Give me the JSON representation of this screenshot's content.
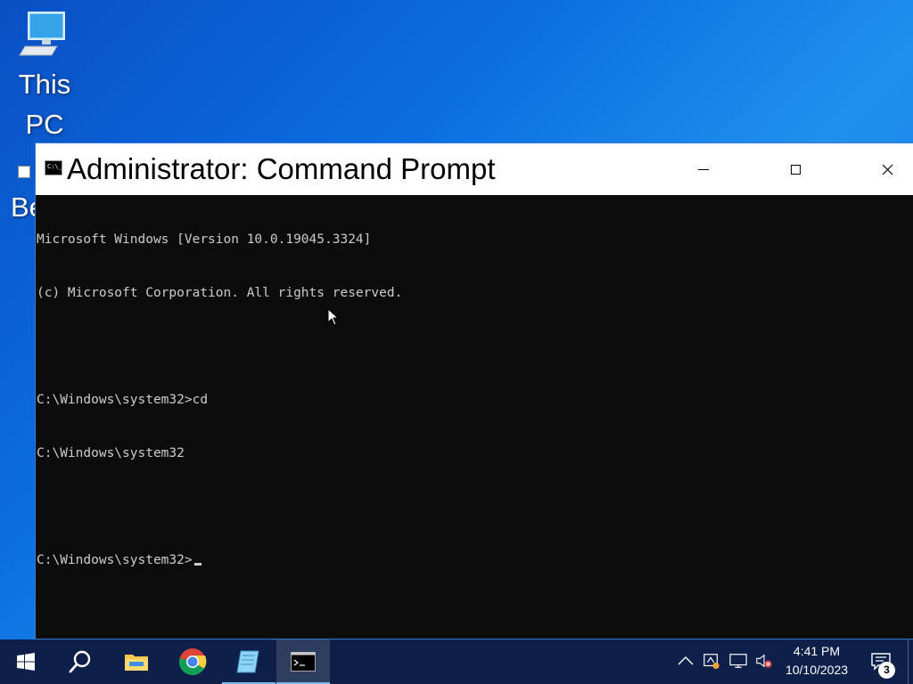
{
  "desktop": {
    "icons": [
      {
        "label_line1": "This",
        "label_line2": "PC"
      },
      {
        "label": "Be"
      }
    ]
  },
  "window": {
    "title": "Administrator: Command Prompt",
    "app_icon_text": "C:\\_",
    "controls": {
      "minimize": "minimize-icon",
      "maximize": "maximize-icon",
      "close": "close-icon"
    }
  },
  "console": {
    "lines": [
      "Microsoft Windows [Version 10.0.19045.3324]",
      "(c) Microsoft Corporation. All rights reserved.",
      "",
      "C:\\Windows\\system32>cd",
      "C:\\Windows\\system32",
      "",
      "C:\\Windows\\system32>"
    ],
    "text_color": "#cccccc",
    "background_color": "#0c0c0c"
  },
  "taskbar": {
    "buttons": [
      {
        "name": "start",
        "icon": "windows-logo-icon"
      },
      {
        "name": "search",
        "icon": "search-icon"
      },
      {
        "name": "file-explorer",
        "icon": "folder-icon",
        "running": false
      },
      {
        "name": "chrome",
        "icon": "chrome-icon",
        "running": false
      },
      {
        "name": "notepad",
        "icon": "notepad-icon",
        "running": true
      },
      {
        "name": "command-prompt",
        "icon": "cmd-icon",
        "running": true,
        "active": true
      }
    ],
    "tray": {
      "icons": [
        "chevron-up-icon",
        "network-warning-icon",
        "display-icon",
        "volume-muted-icon"
      ],
      "time": "4:41 PM",
      "date": "10/10/2023",
      "notification_count": "3"
    },
    "background_color": "#0e1f4a"
  },
  "colors": {
    "desktop_accent": "#0b6fe0",
    "titlebar": "#ffffff",
    "taskbar_highlight": "#76b9ed"
  }
}
